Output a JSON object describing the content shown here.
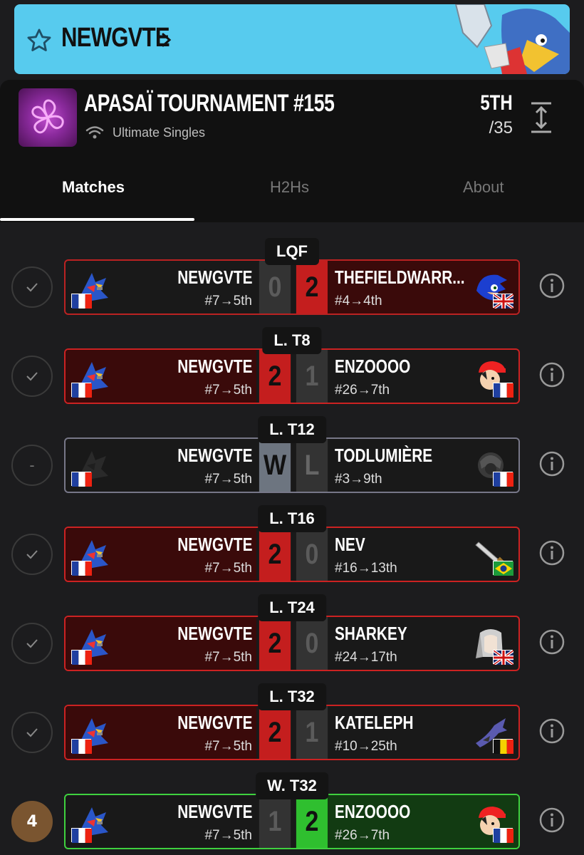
{
  "banner": {
    "player_name": "NEWGVTE",
    "star_icon": "star-icon",
    "chevron_icon": "chevron-right-icon"
  },
  "tournament": {
    "title": "APASAÏ TOURNAMENT #155",
    "subtitle": "Ultimate Singles",
    "placement": "5TH",
    "total": "/35"
  },
  "tabs": [
    {
      "label": "Matches",
      "active": true
    },
    {
      "label": "H2Hs",
      "active": false
    },
    {
      "label": "About",
      "active": false
    }
  ],
  "matches": [
    {
      "round": "LQF",
      "status": "check",
      "left_name": "NEWGVTE",
      "left_seed": "#7→5th",
      "left_score": "0",
      "right_name": "THEFIELDWARR...",
      "right_seed": "#4→4th",
      "right_score": "2",
      "right_flag": "UK"
    },
    {
      "round": "L. T8",
      "status": "check",
      "left_name": "NEWGVTE",
      "left_seed": "#7→5th",
      "left_score": "2",
      "right_name": "ENZOOOO",
      "right_seed": "#26→7th",
      "right_score": "1",
      "right_flag": "FR"
    },
    {
      "round": "L. T12",
      "status": "-",
      "left_name": "NEWGVTE",
      "left_seed": "#7→5th",
      "left_score": "W",
      "right_name": "TODLUMIÈRE",
      "right_seed": "#3→9th",
      "right_score": "L",
      "right_flag": "FR"
    },
    {
      "round": "L. T16",
      "status": "check",
      "left_name": "NEWGVTE",
      "left_seed": "#7→5th",
      "left_score": "2",
      "right_name": "NEV",
      "right_seed": "#16→13th",
      "right_score": "0",
      "right_flag": "BR"
    },
    {
      "round": "L. T24",
      "status": "check",
      "left_name": "NEWGVTE",
      "left_seed": "#7→5th",
      "left_score": "2",
      "right_name": "SHARKEY",
      "right_seed": "#24→17th",
      "right_score": "0",
      "right_flag": "UK"
    },
    {
      "round": "L. T32",
      "status": "check",
      "left_name": "NEWGVTE",
      "left_seed": "#7→5th",
      "left_score": "2",
      "right_name": "KATELEPH",
      "right_seed": "#10→25th",
      "right_score": "1",
      "right_flag": "BE"
    },
    {
      "round": "W. T32",
      "status": "4",
      "left_name": "NEWGVTE",
      "left_seed": "#7→5th",
      "left_score": "1",
      "right_name": "ENZOOOO",
      "right_seed": "#26→7th",
      "right_score": "2",
      "right_flag": "FR"
    }
  ],
  "colors": {
    "banner": "#57cbee",
    "loss_red": "#c41e1e",
    "win_green": "#2fbf2f",
    "background": "#1c1c1e"
  }
}
